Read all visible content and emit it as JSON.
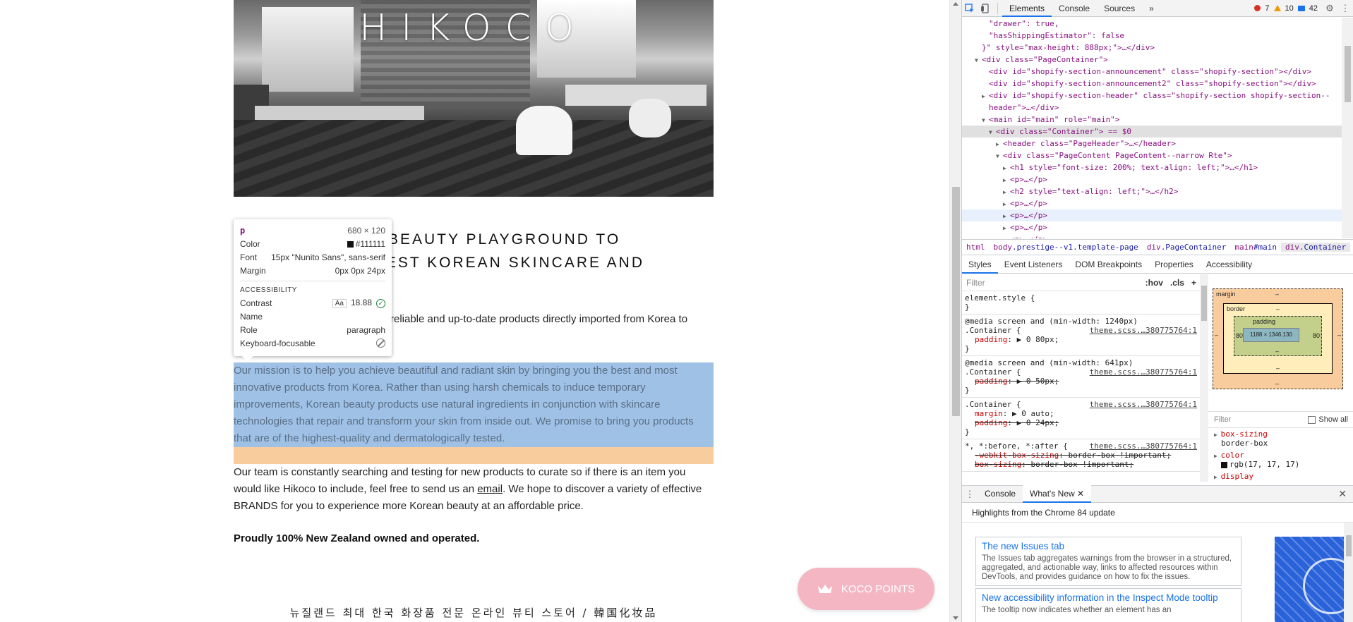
{
  "page": {
    "logo": "HIKOCO",
    "heading_lines": [
      "K-BEAUTY PLAYGROUND TO",
      "TEST KOREAN SKINCARE AND"
    ],
    "intro_lines": [
      "reliable and up-to-date products directly imported from Korea to"
    ],
    "mission": "Our mission is to help you achieve beautiful and radiant skin by bringing you the best and most innovative products from Korea. Rather than using harsh chemicals to induce temporary improvements, Korean beauty products use natural ingredients in conjunction with skincare technologies that repair and transform your skin from inside out. We promise to bring you products that are of the highest-quality and dermatologically tested.",
    "team_before": "Our team is constantly searching and testing for new products to curate so if there is an item you would like Hikoco to include, feel free to send us an ",
    "team_link": "email",
    "team_after": ". We hope to discover a variety of effective BRANDS for you to experience more Korean beauty at an affordable price.",
    "proud": "Proudly 100% New Zealand owned and operated.",
    "korean_footer": "뉴질랜드 최대 한국 화장품 전문 온라인 뷰티 스토어 / 韓国化妆品",
    "koco_button": "KOCO POINTS"
  },
  "tooltip": {
    "tag": "p",
    "size": "680 × 120",
    "color_label": "Color",
    "color_value": "#111111",
    "font_label": "Font",
    "font_value": "15px \"Nunito Sans\", sans-serif",
    "margin_label": "Margin",
    "margin_value": "0px 0px 24px",
    "section": "ACCESSIBILITY",
    "contrast_label": "Contrast",
    "contrast_aa": "Aa",
    "contrast_value": "18.88",
    "name_label": "Name",
    "role_label": "Role",
    "role_value": "paragraph",
    "focus_label": "Keyboard-focusable"
  },
  "devtools": {
    "tabs": [
      "Elements",
      "Console",
      "Sources"
    ],
    "more": "»",
    "errors": "7",
    "warnings": "10",
    "messages": "42",
    "dom_lines": [
      {
        "indent": 3,
        "tri": "",
        "html": "\"drawer\": true,"
      },
      {
        "indent": 3,
        "tri": "",
        "html": "\"hasShippingEstimator\": false"
      },
      {
        "indent": 2,
        "tri": "",
        "html": "}\" style=\"max-height: 888px;\">…</div>"
      },
      {
        "indent": 2,
        "tri": "▼",
        "html": "<div class=\"PageContainer\">"
      },
      {
        "indent": 3,
        "tri": "",
        "html": "<div id=\"shopify-section-announcement\" class=\"shopify-section\"></div>"
      },
      {
        "indent": 3,
        "tri": "",
        "html": "<div id=\"shopify-section-announcement2\" class=\"shopify-section\"></div>"
      },
      {
        "indent": 3,
        "tri": "▶",
        "html": "<div id=\"shopify-section-header\" class=\"shopify-section shopify-section--"
      },
      {
        "indent": 3,
        "tri": "",
        "html": "header\">…</div>"
      },
      {
        "indent": 3,
        "tri": "▼",
        "html": "<main id=\"main\" role=\"main\">"
      },
      {
        "indent": 4,
        "tri": "▼",
        "html": "<div class=\"Container\"> == $0",
        "selected": true
      },
      {
        "indent": 5,
        "tri": "▶",
        "html": "<header class=\"PageHeader\">…</header>"
      },
      {
        "indent": 5,
        "tri": "▼",
        "html": "<div class=\"PageContent PageContent--narrow Rte\">"
      },
      {
        "indent": 6,
        "tri": "▶",
        "html": "<h1 style=\"font-size: 200%; text-align: left;\">…</h1>"
      },
      {
        "indent": 6,
        "tri": "▶",
        "html": "<p>…</p>"
      },
      {
        "indent": 6,
        "tri": "▶",
        "html": "<h2 style=\"text-align: left;\">…</h2>"
      },
      {
        "indent": 6,
        "tri": "▶",
        "html": "<p>…</p>"
      },
      {
        "indent": 6,
        "tri": "▶",
        "html": "<p>…</p>",
        "hovered": true
      },
      {
        "indent": 6,
        "tri": "▶",
        "html": "<p>…</p>"
      },
      {
        "indent": 6,
        "tri": "▶",
        "html": "<p>…</p>"
      }
    ],
    "breadcrumbs": [
      {
        "tag": "html",
        "cls": ""
      },
      {
        "tag": "body",
        "cls": ".prestige--v1.template-page"
      },
      {
        "tag": "div",
        "cls": ".PageContainer"
      },
      {
        "tag": "main",
        "cls": "#main"
      },
      {
        "tag": "div",
        "cls": ".Container"
      }
    ],
    "subtabs": [
      "Styles",
      "Event Listeners",
      "DOM Breakpoints",
      "Properties",
      "Accessibility"
    ],
    "filter_placeholder": "Filter",
    "hov": ":hov",
    "cls": ".cls",
    "plus": "+",
    "rules": [
      {
        "media": "",
        "selector": "element.style {",
        "src": "",
        "props": [],
        "close": "}"
      },
      {
        "media": "@media screen and (min-width: 1240px)",
        "selector": ".Container {",
        "src": "theme.scss.…380775764:1",
        "props": [
          {
            "n": "padding",
            "v": "▶ 0 80px;",
            "strike": false
          }
        ],
        "close": "}"
      },
      {
        "media": "@media screen and (min-width: 641px)",
        "selector": ".Container {",
        "src": "theme.scss.…380775764:1",
        "props": [
          {
            "n": "padding",
            "v": "▶ 0 50px;",
            "strike": true
          }
        ],
        "close": "}"
      },
      {
        "media": "",
        "selector": ".Container {",
        "src": "theme.scss.…380775764:1",
        "props": [
          {
            "n": "margin",
            "v": "▶ 0 auto;",
            "strike": false
          },
          {
            "n": "padding",
            "v": "▶ 0 24px;",
            "strike": true
          }
        ],
        "close": "}"
      },
      {
        "media": "",
        "selector": "*, *:before, *:after {",
        "src": "theme.scss.…380775764:1",
        "props": [
          {
            "n": "-webkit-box-sizing",
            "v": "border-box !important;",
            "strike": true
          },
          {
            "n": "box-sizing",
            "v": "border-box !important;",
            "strike": true
          }
        ],
        "close": ""
      }
    ],
    "boxmodel": {
      "margin": "margin",
      "margin_top": "–",
      "margin_bottom": "–",
      "margin_left": "–",
      "margin_right": "–",
      "border": "border",
      "border_top": "–",
      "border_bottom": "–",
      "padding": "padding",
      "padding_left": "80",
      "padding_right": "80",
      "padding_bottom": "–",
      "content": "1188 × 1346.130"
    },
    "computed_filter": "Filter",
    "show_all": "Show all",
    "computed": [
      {
        "n": "box-sizing",
        "v": "border-box"
      },
      {
        "n": "color",
        "v": "rgb(17, 17, 17)"
      },
      {
        "n": "display",
        "v": ""
      }
    ],
    "drawer_tabs": [
      "Console",
      "What's New"
    ],
    "whatsnew_title": "Highlights from the Chrome 84 update",
    "cards": [
      {
        "title": "The new Issues tab",
        "desc": "The Issues tab aggregates warnings from the browser in a structured, aggregated, and actionable way, links to affected resources within DevTools, and provides guidance on how to fix the issues."
      },
      {
        "title": "New accessibility information in the Inspect Mode tooltip",
        "desc": "The tooltip now indicates whether an element has an"
      }
    ]
  }
}
